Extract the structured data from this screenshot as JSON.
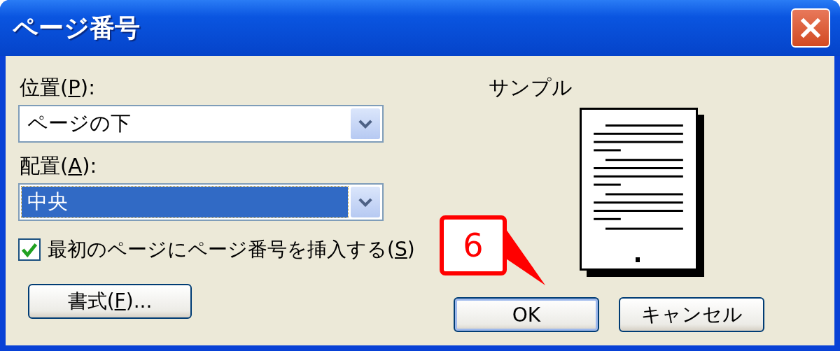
{
  "window": {
    "title": "ページ番号"
  },
  "position": {
    "label": [
      "位置(",
      "P",
      "):"
    ],
    "value": "ページの下",
    "focused": false
  },
  "alignment": {
    "label": [
      "配置(",
      "A",
      "):"
    ],
    "value": "中央",
    "focused": true
  },
  "first_page": {
    "label": [
      "最初のページにページ番号を挿入する(",
      "S",
      ")"
    ],
    "checked": true
  },
  "preview": {
    "label": "サンプル"
  },
  "buttons": [
    {
      "label": [
        "書式(",
        "F",
        ")..."
      ],
      "default": false
    },
    {
      "label": [
        "OK"
      ],
      "default": true
    },
    {
      "label": [
        "キャンセル"
      ],
      "default": false
    }
  ],
  "callout": {
    "text": "6"
  }
}
